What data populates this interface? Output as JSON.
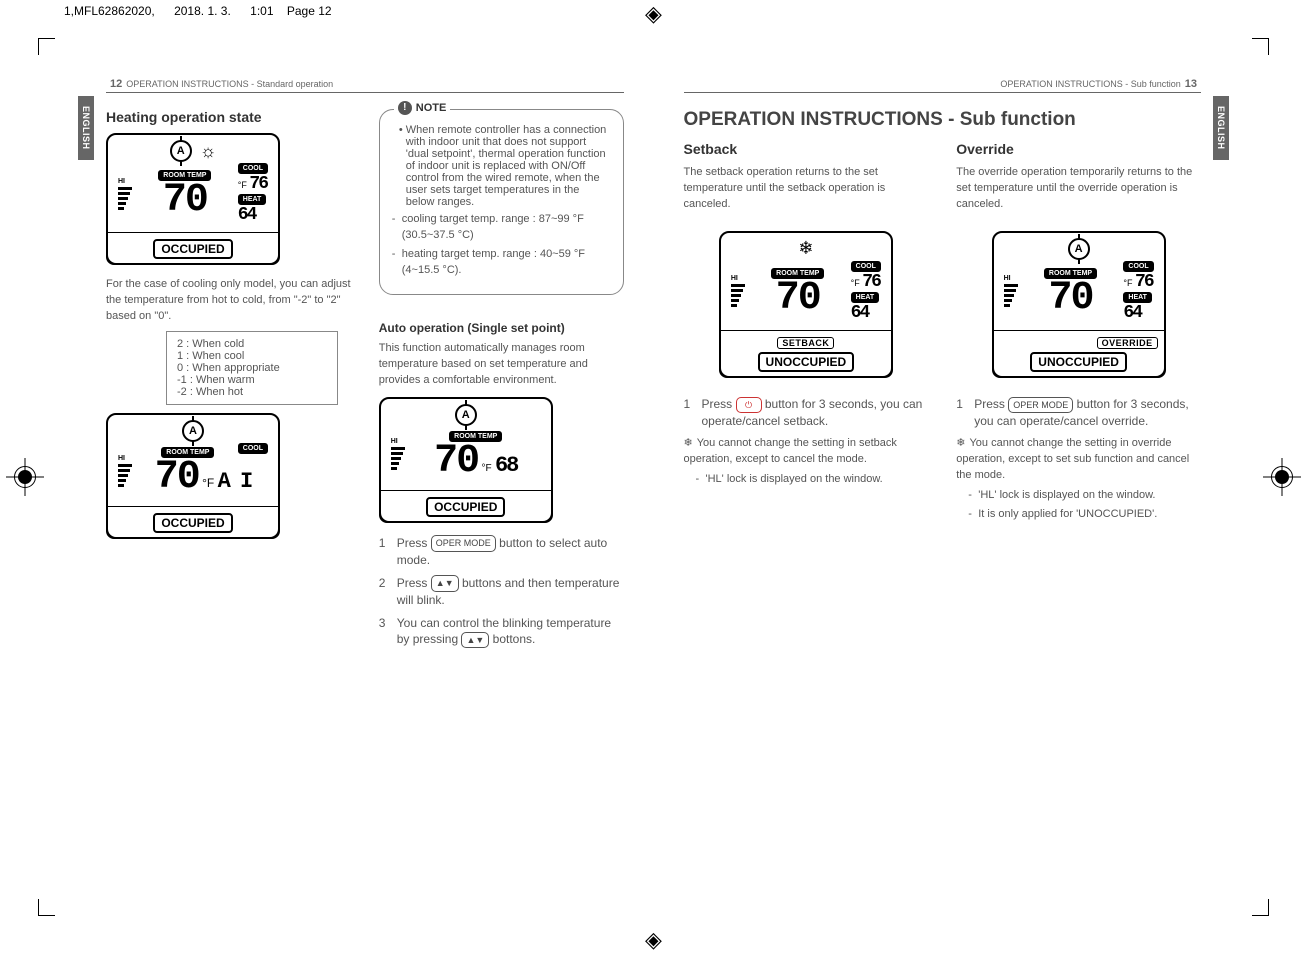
{
  "meta": {
    "slug": "1,MFL62862020,",
    "date": "2018. 1. 3.",
    "time": "1:01",
    "page_stamp": "Page 12"
  },
  "left_page": {
    "number": "12",
    "header": "OPERATION INSTRUCTIONS - Standard operation",
    "side_tab": "ENGLISH",
    "heating": {
      "title": "Heating operation state",
      "device": {
        "mode_icon": "sun",
        "room_temp_label": "ROOM TEMP",
        "cool_label": "COOL",
        "heat_label": "HEAT",
        "unit": "°F",
        "big": "70",
        "cool_set": "76",
        "heat_set": "64",
        "status": "OCCUPIED"
      },
      "blurb": "For the case of cooling only model, you can adjust the temperature from hot to cold, from \"-2\" to \"2\" based on \"0\".",
      "scale": [
        "2 : When cold",
        "1 : When cool",
        "0 : When appropriate",
        "-1 : When warm",
        "-2 : When hot"
      ],
      "device2": {
        "room_temp_label": "ROOM TEMP",
        "cool_label": "COOL",
        "unit": "°F",
        "big": "70",
        "side": "A I",
        "status": "OCCUPIED"
      }
    },
    "note": {
      "label": "NOTE",
      "body": "When remote controller has a connection with indoor unit that does not support 'dual setpoint', thermal operation function of indoor unit is replaced with ON/Off control from the wired remote, when the user sets target temperatures in the below ranges.",
      "lines": [
        "cooling target temp. range : 87~99 °F (30.5~37.5 °C)",
        "heating target temp. range : 40~59 °F (4~15.5 °C)."
      ]
    },
    "auto": {
      "title": "Auto operation (Single set point)",
      "blurb": "This function automatically manages room temperature based on set temperature and provides a comfortable environment.",
      "device": {
        "room_temp_label": "ROOM TEMP",
        "unit": "°F",
        "big": "70",
        "side": "68",
        "status": "OCCUPIED"
      },
      "steps": [
        {
          "n": "1",
          "pre": "Press",
          "btn": "OPER MODE",
          "post": "button to select auto mode."
        },
        {
          "n": "2",
          "pre": "Press",
          "btn": "▲▼",
          "post": "buttons and then temperature will blink."
        },
        {
          "n": "3",
          "pre": "You can control the blinking temperature by pressing",
          "btn": "▲▼",
          "post": "bottons."
        }
      ]
    }
  },
  "right_page": {
    "number": "13",
    "header": "OPERATION INSTRUCTIONS - Sub function",
    "side_tab": "ENGLISH",
    "title": "OPERATION INSTRUCTIONS - Sub function",
    "setback": {
      "title": "Setback",
      "blurb": "The setback operation returns to the set temperature until the setback operation is canceled.",
      "device": {
        "mode_icon": "snow",
        "room_temp_label": "ROOM TEMP",
        "cool_label": "COOL",
        "heat_label": "HEAT",
        "unit": "°F",
        "big": "70",
        "cool_set": "76",
        "heat_set": "64",
        "status1": "SETBACK",
        "status2": "UNOCCUPIED"
      },
      "step": {
        "n": "1",
        "pre": "Press",
        "btn": "⏻",
        "post": "button for 3 seconds, you can operate/cancel setback."
      },
      "notes": [
        "You cannot change the setting in setback operation, except to cancel the mode.",
        "'HL' lock is displayed on the window."
      ]
    },
    "override": {
      "title": "Override",
      "blurb": "The override operation temporarily returns to the set temperature until the override operation is canceled.",
      "device": {
        "mode_icon": "a",
        "room_temp_label": "ROOM TEMP",
        "cool_label": "COOL",
        "heat_label": "HEAT",
        "unit": "°F",
        "big": "70",
        "cool_set": "76",
        "heat_set": "64",
        "status1": "OVERRIDE",
        "status2": "UNOCCUPIED"
      },
      "step": {
        "n": "1",
        "pre": "Press",
        "btn": "OPER MODE",
        "post": "button for 3 seconds, you can operate/cancel override."
      },
      "notes": [
        "You cannot change the setting in override operation, except to set sub function and cancel the mode.",
        "'HL' lock is displayed on the window.",
        "It is only applied for 'UNOCCUPIED'."
      ]
    }
  }
}
